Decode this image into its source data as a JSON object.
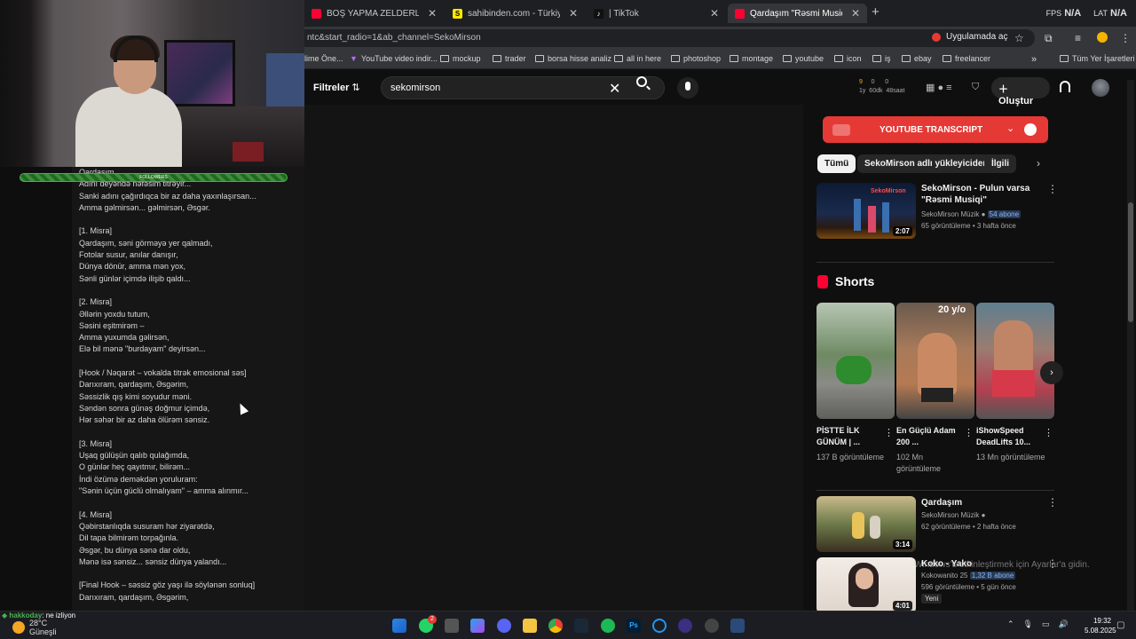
{
  "browser": {
    "tabs": [
      {
        "label": "BOŞ YAPMA ZELDERLER - YouTu",
        "favicon": "youtube-icon",
        "active": false
      },
      {
        "label": "sahibinden.com - Türkiye'nin O",
        "favicon": "sahibinden-icon",
        "active": false
      },
      {
        "label": "| TikTok",
        "favicon": "tiktok-icon",
        "active": false
      },
      {
        "label": "Qardaşım \"Rəsmi Musiqi\" - You",
        "favicon": "youtube-icon",
        "active": true
      }
    ],
    "new_tab": "+",
    "address": "ntc&start_radio=1&ab_channel=SekoMirson",
    "open_in_app": "Uygulamada aç",
    "bookmarks": [
      "lime Öne...",
      "YouTube video indir...",
      "mockup",
      "trader",
      "borsa hisse analiz",
      "all in here",
      "photoshop",
      "montage",
      "youtube",
      "icon",
      "iş",
      "ebay",
      "freelancer"
    ],
    "bookmarks_overflow": "»",
    "all_bookmarks": "Tüm Yer İşaretleri"
  },
  "stream_overlay": {
    "fps": "FPS",
    "fps_value": "N/A",
    "lat": "LAT",
    "lat_value": "N/A",
    "follow_goal": "FOLLOWERS",
    "viewer": "hakkoday",
    "viewer_action": ": ne izliyon"
  },
  "youtube": {
    "filters": "Filtreler",
    "search_value": "sekomirson",
    "stats": {
      "a": "9",
      "b": "0",
      "c": "0",
      "d": "1y",
      "e": "60dk",
      "f": "48saat"
    },
    "create": "Oluştur",
    "transcript_button": "YOUTUBE TRANSCRIPT",
    "chips": [
      "Tümü",
      "SekoMirson adlı yükleyiciden",
      "İlgili"
    ],
    "videos": [
      {
        "title": "SekoMirson - Pulun varsa \"Rəsmi Musiqi\"",
        "channel": "SekoMirson Müzik",
        "subs": "54 abone",
        "meta": "65 görüntüleme • 3 hafta önce",
        "duration": "2:07",
        "thumb_label": "SekoMirson"
      },
      {
        "title": "Qardaşım",
        "channel": "SekoMirson Müzik",
        "meta": "62 görüntüleme • 2 hafta önce",
        "duration": "3:14"
      },
      {
        "title": "Koko - Yako",
        "channel": "Kokowanito 25",
        "subs": "1,32 B abone",
        "meta": "596 görüntüleme • 5 gün önce",
        "duration": "4:01",
        "badge": "Yeni"
      }
    ],
    "shorts_title": "Shorts",
    "shorts": [
      {
        "title": "PİSTTE İLK GÜNÜM | ...",
        "views": "137 B görüntüleme"
      },
      {
        "title": "En Güçlü Adam 200 ...",
        "views": "102 Mn görüntüleme",
        "overlay": "20 y/o"
      },
      {
        "title": "iShowSpeed DeadLifts 10...",
        "views": "13 Mn görüntüleme"
      }
    ]
  },
  "lyrics": [
    "Qardaşım...",
    "Adını deyəndə nəfəsim titrəyir...",
    "Sanki adını çağırdıqca bir az daha yaxınlaşırsan...",
    "Amma gəlmirsən... gəlmirsən, Əsgər.",
    "",
    "[1. Misra]",
    "Qardaşım, səni görməyə yer qalmadı,",
    "Fotolar susur, anılar danışır,",
    "Dünya dönür, amma mən yox,",
    "Sənli günlər içimdə ilişib qaldı...",
    "",
    "[2. Misra]",
    "Əllərin yoxdu tutum,",
    "Səsini eşitmirəm –",
    "Amma yuxumda gəlirsən,",
    "Elə bil mənə \"burdayam\" deyirsən...",
    "",
    "[Hook / Nəqarət – vokalda titrək emosional səs]",
    "Darıxıram, qardaşım, Əsgərim,",
    "Səssizlik qış kimi soyudur məni.",
    "Səndən sonra günəş doğmur içimdə,",
    "Hər səhər bir az daha ölürəm sənsiz.",
    "",
    "[3. Misra]",
    "Uşaq gülüşün qalıb qulağımda,",
    "O günlər heç qayıtmır, bilirəm...",
    "İndi özümə deməkdən yoruluram:",
    "\"Sənin üçün güclü olmalıyam\" – amma alınmır...",
    "",
    "[4. Misra]",
    "Qəbirstanlıqda susuram hər ziyarətdə,",
    "Dil tapa bilmirəm torpağınla.",
    "Əsgər, bu dünya sənə dar oldu,",
    "Mənə isə sənsiz... sənsiz dünya yalandı...",
    "",
    "[Final Hook – səssiz göz yaşı ilə söylənən sonluq]",
    "Darıxıram, qardaşım, Əsgərim,"
  ],
  "windows": {
    "activate": "Windows'u etkinleştirmek için Ayarlar'a gidin.",
    "weather_temp": "28°C",
    "weather_desc": "Güneşli",
    "time": "19:32",
    "date": "5.08.2025",
    "notif_badge": "2"
  }
}
